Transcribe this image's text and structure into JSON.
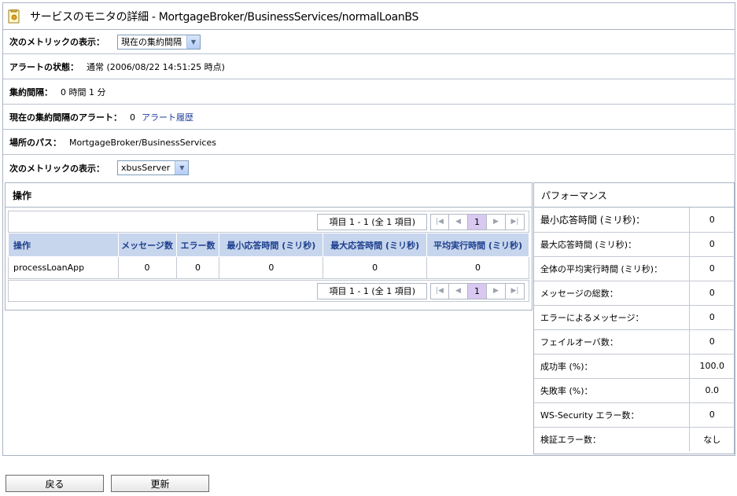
{
  "title": "サービスのモニタの詳細 - MortgageBroker/BusinessServices/normalLoanBS",
  "icons": {
    "title": "monitor-detail-icon"
  },
  "metric_display_1": {
    "label": "次のメトリックの表示：",
    "value": "現在の集約間隔"
  },
  "alert_status": {
    "label": "アラートの状態：",
    "value": "通常 (2006/08/22 14:51:25 時点)"
  },
  "aggregation_interval": {
    "label": "集約間隔：",
    "value": "0 時間 1 分"
  },
  "current_alerts": {
    "label": "現在の集約間隔のアラート：",
    "value": "0",
    "link": "アラート履歴"
  },
  "location_path": {
    "label": "場所のパス：",
    "value": "MortgageBroker/BusinessServices"
  },
  "metric_display_2": {
    "label": "次のメトリックの表示：",
    "value": "xbusServer"
  },
  "operations": {
    "title": "操作",
    "pager": {
      "info": "項目 1 - 1 (全 1 項目)",
      "page": "1"
    },
    "columns": [
      "操作",
      "メッセージ数",
      "エラー数",
      "最小応答時間 (ミリ秒)",
      "最大応答時間 (ミリ秒)",
      "平均実行時間 (ミリ秒)"
    ],
    "rows": [
      [
        "processLoanApp",
        "0",
        "0",
        "0",
        "0",
        "0"
      ]
    ]
  },
  "performance": {
    "title": "パフォーマンス",
    "items": [
      {
        "label": "最小応答時間 (ミリ秒)：",
        "value": "0"
      },
      {
        "label": "最大応答時間 (ミリ秒)：",
        "value": "0"
      },
      {
        "label": "全体の平均実行時間 (ミリ秒)：",
        "value": "0"
      },
      {
        "label": "メッセージの総数：",
        "value": "0"
      },
      {
        "label": "エラーによるメッセージ：",
        "value": "0"
      },
      {
        "label": "フェイルオーバ数：",
        "value": "0"
      },
      {
        "label": "成功率 (%)：",
        "value": "100.0"
      },
      {
        "label": "失敗率 (%)：",
        "value": "0.0"
      },
      {
        "label": "WS-Security エラー数：",
        "value": "0"
      },
      {
        "label": "検証エラー数：",
        "value": "なし"
      }
    ]
  },
  "buttons": {
    "back": "戻る",
    "refresh": "更新"
  }
}
